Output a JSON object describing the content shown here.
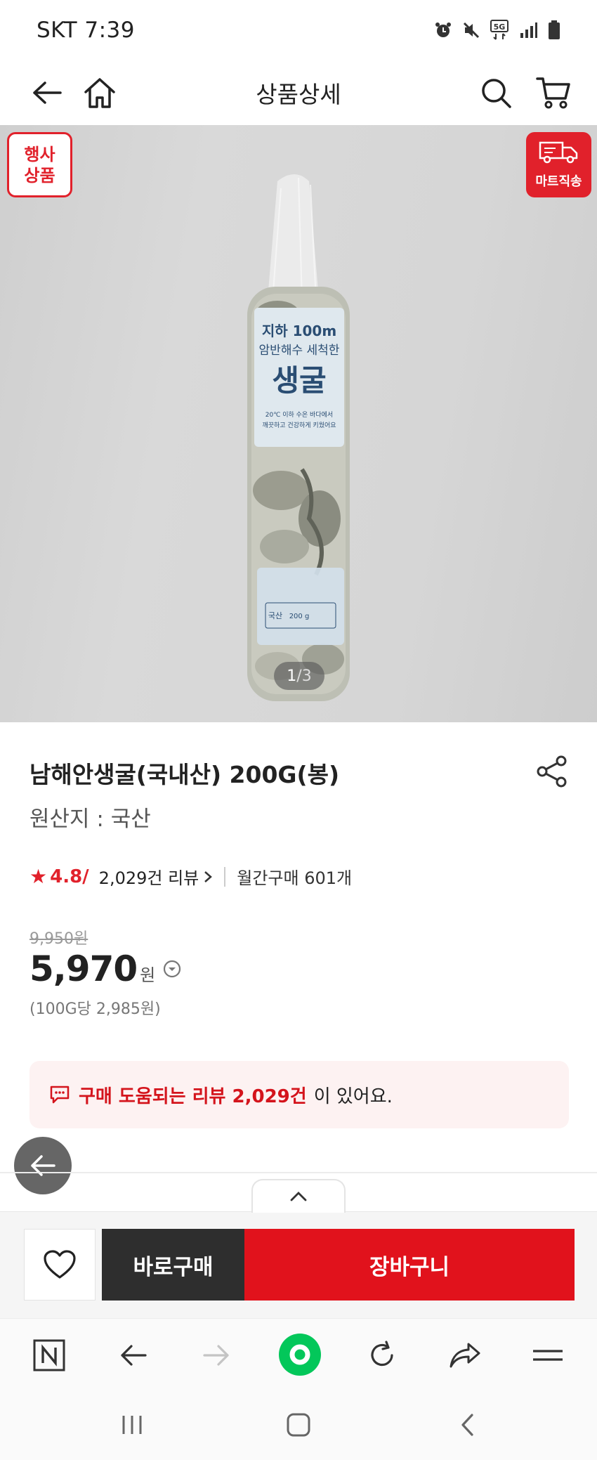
{
  "status_bar": {
    "carrier_time": "SKT 7:39",
    "icons": [
      "alarm-icon",
      "mute-icon",
      "5g-icon",
      "signal-icon",
      "battery-icon"
    ],
    "network_label": "5G"
  },
  "header": {
    "title": "상품상세",
    "left_icons": [
      "back-arrow-icon",
      "home-icon"
    ],
    "right_icons": [
      "search-icon",
      "cart-icon"
    ]
  },
  "gallery": {
    "event_badge_line1": "행사",
    "event_badge_line2": "상품",
    "mart_badge": "마트직송",
    "counter_current": "1",
    "counter_total": "/3",
    "package": {
      "line1": "지하 100m",
      "line2": "암반해수 세척한",
      "line3": "생굴",
      "line4": "20℃ 이하 수온 바다에서",
      "line5": "깨끗하고 건강하게 키웠어요",
      "spec1": "국산",
      "spec2": "200 g"
    }
  },
  "product": {
    "name": "남해안생굴(국내산) 200G(봉)",
    "origin": "원산지 : 국산",
    "rating": "4.8/",
    "reviews_link": "2,029건 리뷰",
    "monthly_sales": "월간구매 601개",
    "original_price": "9,950원",
    "sale_price": "5,970",
    "currency": "원",
    "unit_price": "(100G당 2,985원)",
    "review_banner_highlight": "구매 도움되는 리뷰 2,029건",
    "review_banner_rest": "이 있어요."
  },
  "purchase_bar": {
    "buy_now": "바로구매",
    "add_to_cart": "장바구니"
  },
  "browser_toolbar": {
    "buttons": [
      "naver-icon",
      "back-icon",
      "forward-icon",
      "home-circle-icon",
      "refresh-icon",
      "share-icon",
      "menu-icon"
    ]
  },
  "colors": {
    "accent_red": "#e1212b",
    "buy_now_dark": "#2e2e2e",
    "review_banner_bg": "#fdf2f2",
    "naver_green": "#03c75a"
  }
}
